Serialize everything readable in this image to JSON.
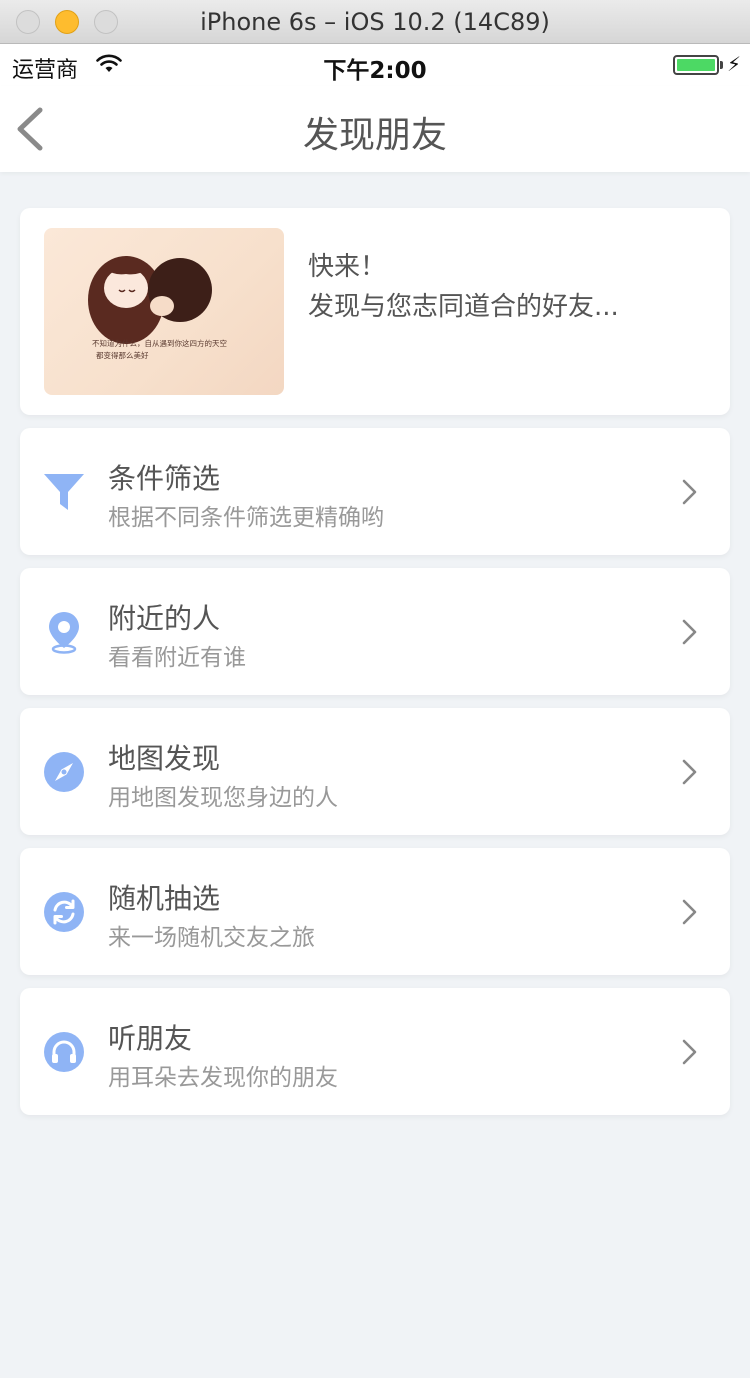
{
  "window": {
    "title": "iPhone 6s – iOS 10.2 (14C89)"
  },
  "status": {
    "carrier": "运营商",
    "time": "下午2:00",
    "battery_level": 1.0
  },
  "nav": {
    "title": "发现朋友"
  },
  "hero": {
    "line1": "快来！",
    "line2": "发现与您志同道合的好友...",
    "image_caption_1": "不知道为什么，自从遇到你这四方的天空",
    "image_caption_2": "都变得那么美好"
  },
  "menu": [
    {
      "title": "条件筛选",
      "subtitle": "根据不同条件筛选更精确哟",
      "icon": "filter-icon"
    },
    {
      "title": "附近的人",
      "subtitle": "看看附近有谁",
      "icon": "location-pin-icon"
    },
    {
      "title": "地图发现",
      "subtitle": "用地图发现您身边的人",
      "icon": "compass-icon"
    },
    {
      "title": "随机抽选",
      "subtitle": "来一场随机交友之旅",
      "icon": "refresh-icon"
    },
    {
      "title": "听朋友",
      "subtitle": "用耳朵去发现你的朋友",
      "icon": "headphones-icon"
    }
  ],
  "colors": {
    "accent": "#8fb4f5",
    "background": "#f0f3f6",
    "battery": "#4cd964"
  }
}
